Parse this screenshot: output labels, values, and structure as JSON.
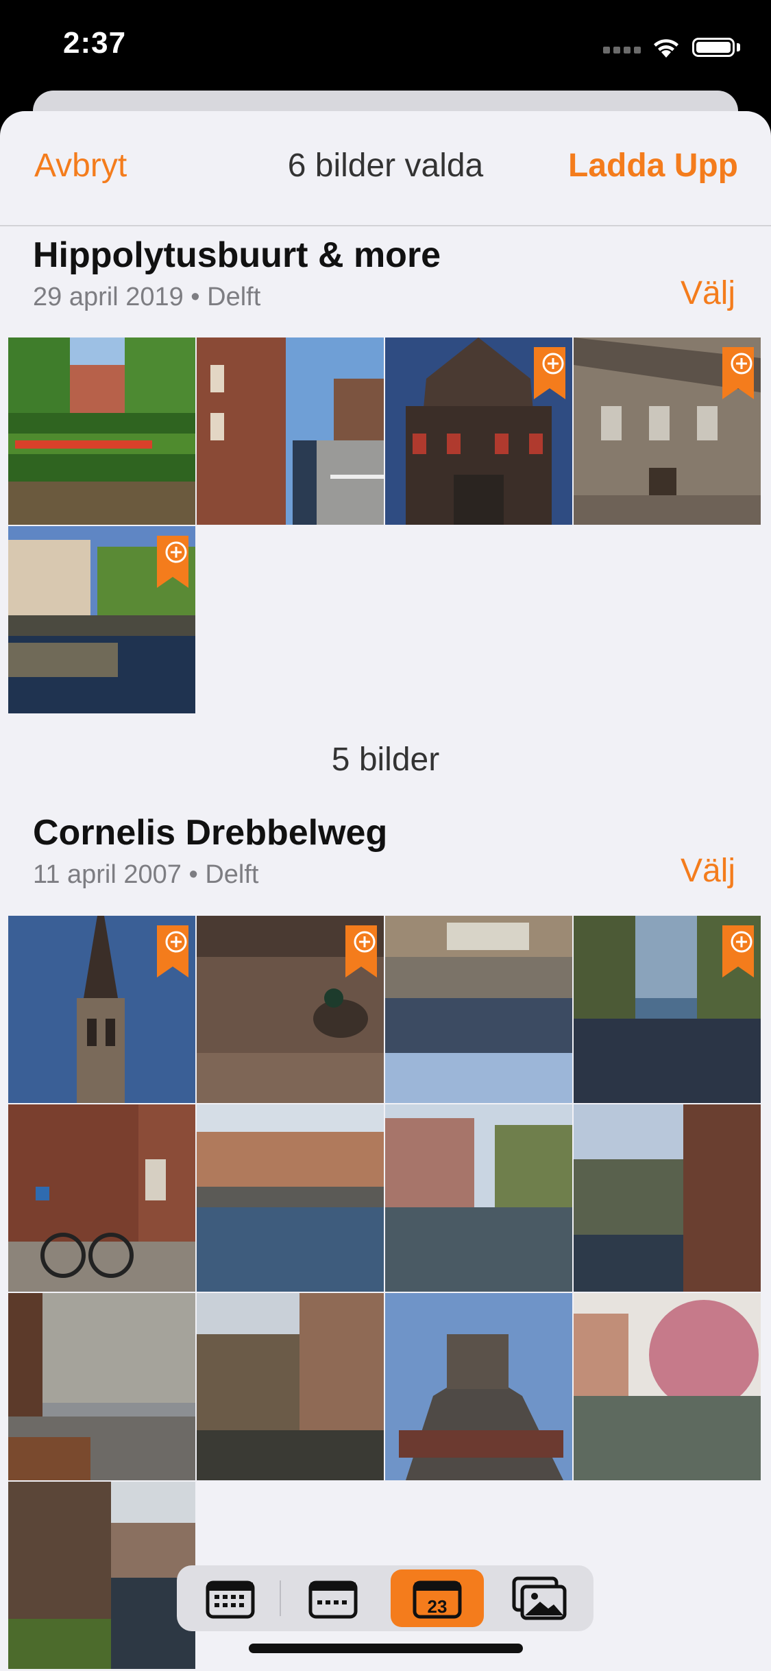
{
  "status_bar": {
    "time": "2:37"
  },
  "nav": {
    "cancel_label": "Avbryt",
    "title": "6 bilder valda",
    "upload_label": "Ladda Upp"
  },
  "sections": [
    {
      "title": "Hippolytusbuurt & more",
      "subtitle": "29 april 2019 • Delft",
      "select_label": "Välj",
      "count_label": "5 bilder",
      "photos": [
        {
          "scene": "garden-tulips",
          "selected": false
        },
        {
          "scene": "narrow-canal-street",
          "selected": false
        },
        {
          "scene": "ornate-facade",
          "selected": true
        },
        {
          "scene": "stone-building",
          "selected": true
        },
        {
          "scene": "canal-reflection",
          "selected": true
        }
      ]
    },
    {
      "title": "Cornelis Drebbelweg",
      "subtitle": "11 april 2007 • Delft",
      "select_label": "Välj",
      "photos": [
        {
          "scene": "church-tower",
          "selected": true
        },
        {
          "scene": "duck-cobbles",
          "selected": true
        },
        {
          "scene": "canal-bicycles",
          "selected": false
        },
        {
          "scene": "tree-lined-canal",
          "selected": true
        },
        {
          "scene": "bicycle-brick-wall",
          "selected": false
        },
        {
          "scene": "canal-bridge",
          "selected": false
        },
        {
          "scene": "canal-street-trees",
          "selected": false
        },
        {
          "scene": "church-wall-trees",
          "selected": false
        },
        {
          "scene": "town-square",
          "selected": false
        },
        {
          "scene": "canal-street-umbrellas",
          "selected": false
        },
        {
          "scene": "city-hall-roof",
          "selected": false
        },
        {
          "scene": "blossom-canal",
          "selected": false
        },
        {
          "scene": "canal-walkway",
          "selected": false
        }
      ]
    }
  ],
  "toolbar": {
    "items": [
      {
        "icon": "calendar-year-icon",
        "active": false
      },
      {
        "icon": "calendar-month-icon",
        "active": false
      },
      {
        "icon": "calendar-day-icon",
        "active": true,
        "label": "23"
      },
      {
        "icon": "photos-icon",
        "active": false
      }
    ]
  },
  "colors": {
    "accent": "#f47c1c",
    "sheet_bg": "#f1f1f6",
    "status_bg": "#000000"
  }
}
